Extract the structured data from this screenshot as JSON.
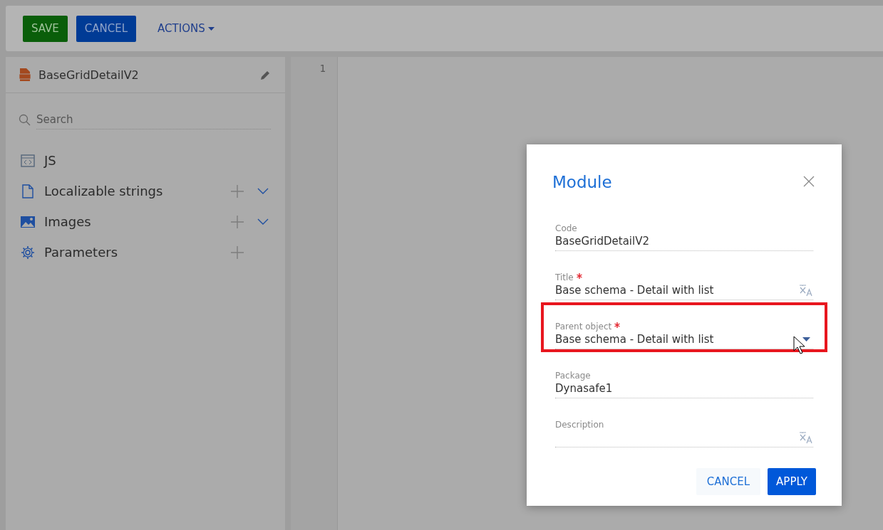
{
  "toolbar": {
    "save": "SAVE",
    "cancel": "CANCEL",
    "actions": "ACTIONS"
  },
  "sidebar": {
    "schema_name": "BaseGridDetailV2",
    "search": {
      "placeholder": "Search"
    },
    "items": [
      {
        "kind": "js",
        "label": "JS",
        "can_add": false,
        "expandable": false
      },
      {
        "kind": "strings",
        "label": "Localizable strings",
        "can_add": true,
        "expandable": true
      },
      {
        "kind": "images",
        "label": "Images",
        "can_add": true,
        "expandable": true
      },
      {
        "kind": "parameters",
        "label": "Parameters",
        "can_add": true,
        "expandable": false
      }
    ]
  },
  "editor": {
    "line_numbers": [
      "1"
    ]
  },
  "dialog": {
    "title": "Module",
    "fields": [
      {
        "kind": "text",
        "label": "Code",
        "value": "BaseGridDetailV2",
        "required": false,
        "translatable": false,
        "highlighted": false
      },
      {
        "kind": "text",
        "label": "Title",
        "value": "Base schema - Detail with list",
        "required": true,
        "translatable": true,
        "highlighted": false
      },
      {
        "kind": "lookup",
        "label": "Parent object",
        "value": "Base schema - Detail with list",
        "required": true,
        "translatable": false,
        "highlighted": true
      },
      {
        "kind": "text",
        "label": "Package",
        "value": "Dynasafe1",
        "required": false,
        "translatable": false,
        "highlighted": false
      },
      {
        "kind": "text",
        "label": "Description",
        "required": false,
        "translatable": true,
        "highlighted": false
      }
    ],
    "cancel": "CANCEL",
    "apply": "APPLY"
  }
}
